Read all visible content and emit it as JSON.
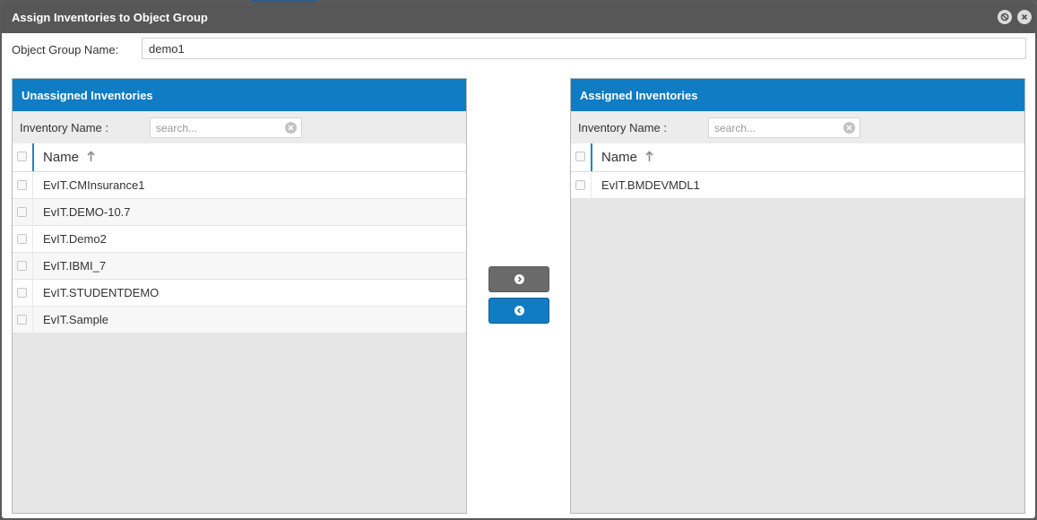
{
  "dialog": {
    "title": "Assign Inventories to Object Group",
    "icons": {
      "minimize": "block-icon",
      "close": "close-icon"
    }
  },
  "object_group": {
    "label": "Object Group Name:",
    "value": "demo1"
  },
  "unassigned": {
    "header": "Unassigned Inventories",
    "filter_label": "Inventory Name :",
    "search_placeholder": "search...",
    "column": "Name",
    "rows": [
      "EvIT.CMInsurance1",
      "EvIT.DEMO-10.7",
      "EvIT.Demo2",
      "EvIT.IBMI_7",
      "EvIT.STUDENTDEMO",
      "EvIT.Sample"
    ]
  },
  "assigned": {
    "header": "Assigned Inventories",
    "filter_label": "Inventory Name :",
    "search_placeholder": "search...",
    "column": "Name",
    "rows": [
      "EvIT.BMDEVMDL1"
    ]
  },
  "colors": {
    "header_blue": "#0f7cc4",
    "titlebar": "#575757",
    "move_right_button": "#6a6a6a",
    "move_left_button": "#0f7cc4"
  }
}
